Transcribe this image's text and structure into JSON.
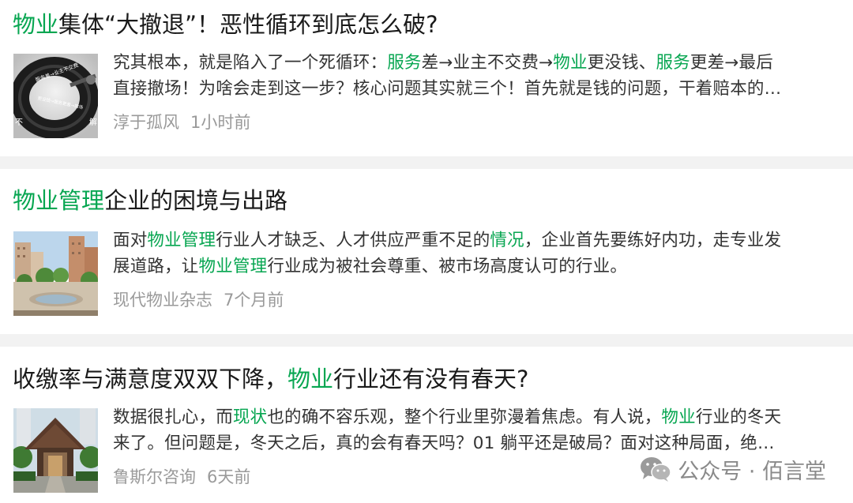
{
  "articles": [
    {
      "title": [
        {
          "text": "物业",
          "highlight": true
        },
        {
          "text": "集体“大撤退”！恶性循环到底怎么破?",
          "highlight": false
        }
      ],
      "snippet_lines": [
        [
          {
            "text": "究其根本，就是陷入了一个死循环：",
            "highlight": false
          },
          {
            "text": "服务",
            "highlight": true
          },
          {
            "text": "差→业主不交费→",
            "highlight": false
          },
          {
            "text": "物业",
            "highlight": true
          },
          {
            "text": "更没钱、",
            "highlight": false
          },
          {
            "text": "服务",
            "highlight": true
          },
          {
            "text": "更差→最后",
            "highlight": false
          }
        ],
        [
          {
            "text": "直接撤场！为啥会走到这一步？核心问题其实就三个！首先就是钱的问题，干着赔本的…",
            "highlight": false
          }
        ]
      ],
      "source": "淳于孤风",
      "time": "1小时前",
      "thumb_icon": "dark-ring-thumbnail",
      "thumb_text": [
        "服务差→业主不交费",
        "不",
        "解",
        "更没钱→服务更差→撤场"
      ]
    },
    {
      "title": [
        {
          "text": "物业管理",
          "highlight": true
        },
        {
          "text": "企业的困境与出路",
          "highlight": false
        }
      ],
      "snippet_lines": [
        [
          {
            "text": "面对",
            "highlight": false
          },
          {
            "text": "物业管理",
            "highlight": true
          },
          {
            "text": "行业人才缺乏、人才供应严重不足的",
            "highlight": false
          },
          {
            "text": "情况",
            "highlight": true
          },
          {
            "text": "，企业首先要练好内功，走专业发",
            "highlight": false
          }
        ],
        [
          {
            "text": "展道路，让",
            "highlight": false
          },
          {
            "text": "物业管理",
            "highlight": true
          },
          {
            "text": "行业成为被社会尊重、被市场高度认可的行业。",
            "highlight": false
          }
        ]
      ],
      "source": "现代物业杂志",
      "time": "7个月前",
      "thumb_icon": "residential-plaza-thumbnail"
    },
    {
      "title": [
        {
          "text": "收缴率与满意度双双下降，",
          "highlight": false
        },
        {
          "text": "物业",
          "highlight": true
        },
        {
          "text": "行业还有没有春天?",
          "highlight": false
        }
      ],
      "snippet_lines": [
        [
          {
            "text": "数据很扎心，而",
            "highlight": false
          },
          {
            "text": "现状",
            "highlight": true
          },
          {
            "text": "也的确不容乐观，整个行业里弥漫着焦虑。有人说，",
            "highlight": false
          },
          {
            "text": "物业",
            "highlight": true
          },
          {
            "text": "行业的冬天",
            "highlight": false
          }
        ],
        [
          {
            "text": "来了。但问题是，冬天之后，真的会有春天吗？01 躺平还是破局？面对这种局面，绝…",
            "highlight": false
          }
        ]
      ],
      "source": "鲁斯尔咨询",
      "time": "6天前",
      "thumb_icon": "community-gate-thumbnail"
    }
  ],
  "watermark": {
    "text": "公众号 · 佰言堂",
    "icon": "wechat-icon"
  },
  "colors": {
    "highlight": "#07a651",
    "title": "#1a1a1a",
    "snippet": "#333333",
    "meta": "#9a9a9a",
    "separator": "#f2f2f2"
  }
}
